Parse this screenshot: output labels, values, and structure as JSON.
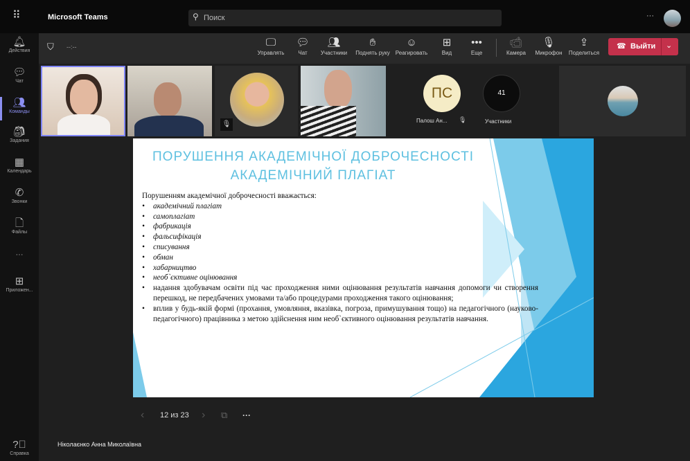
{
  "app": {
    "title": "Microsoft Teams",
    "search_placeholder": "Поиск",
    "more": "···"
  },
  "sidebar": [
    {
      "label": "Действия",
      "icon": "bell-icon"
    },
    {
      "label": "Чат",
      "icon": "chat-icon"
    },
    {
      "label": "Команды",
      "icon": "teams-icon",
      "active": true
    },
    {
      "label": "Задания",
      "icon": "backpack-icon"
    },
    {
      "label": "Календарь",
      "icon": "calendar-icon"
    },
    {
      "label": "Звонки",
      "icon": "phone-icon"
    },
    {
      "label": "Файлы",
      "icon": "file-icon"
    },
    {
      "label": "···",
      "icon": "more-icon"
    },
    {
      "label": "Приложен...",
      "icon": "apps-icon"
    },
    {
      "label": "Справка",
      "icon": "help-icon"
    }
  ],
  "toolbar": {
    "timer": "--:--",
    "buttons": [
      "Управлять",
      "Чат",
      "Участники",
      "Поднять руку",
      "Реагировать",
      "Вид",
      "Еще",
      "Камера",
      "Микрофон",
      "Поделиться"
    ],
    "leave": "Выйти"
  },
  "participants": {
    "initials": "ПС",
    "name": "Палош Ан...",
    "count": "41",
    "count_label": "Участники"
  },
  "slide": {
    "title1": "ПОРУШЕННЯ АКАДЕМІЧНОЇ ДОБРОЧЕСНОСТІ",
    "title2": "АКАДЕМІЧНИЙ ПЛАГІАТ",
    "intro": "Порушенням академічної доброчесності вважається:",
    "items": [
      "академічний плагіат",
      "самоплагіат",
      "фабрикація",
      "фальсифікація",
      "списування",
      "обман",
      "хабарництво",
      "необ`єктивне оцінювання"
    ],
    "long_items": [
      "надання здобувачам освіти під час проходження ними оцінювання результатів навчання допомоги чи створення перешкод, не передбачених умовами та/або процедурами проходження такого оцінювання;",
      "вплив у будь-якій формі (прохання, умовляння, вказівка, погроза, примушування тощо) на педагогічного (науково-педагогічного) працівника з метою здійснення ним необ`єктивного оцінювання результатів навчання."
    ]
  },
  "pager": {
    "text": "12 из 23",
    "more": "···"
  },
  "presenter": "Ніколаєнко Анна Миколаївна",
  "colors": {
    "accent": "#8b8ff0",
    "leave": "#c4314b",
    "slide_title": "#5ec0e0"
  }
}
